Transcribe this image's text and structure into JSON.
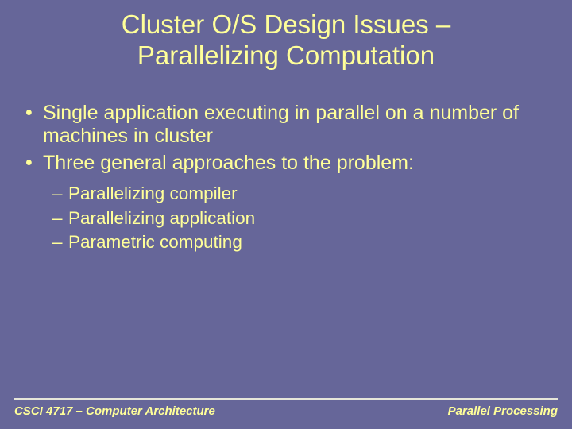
{
  "title_line1": "Cluster O/S Design Issues –",
  "title_line2": "Parallelizing Computation",
  "bullets": {
    "b1": "Single application executing in parallel on a number of machines in cluster",
    "b2": "Three general approaches to the problem:",
    "s1": "Parallelizing compiler",
    "s2": "Parallelizing application",
    "s3": "Parametric computing"
  },
  "footer": {
    "left": "CSCI 4717 – Computer Architecture",
    "right": "Parallel Processing"
  }
}
